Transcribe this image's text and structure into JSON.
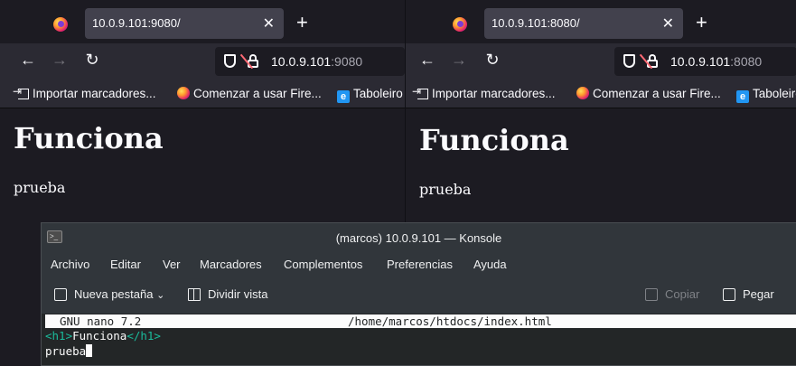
{
  "browser_left": {
    "tab_title": "10.0.9.101:9080/",
    "url_host": "10.0.9.101",
    "url_port": ":9080",
    "bookmarks": [
      "Importar marcadores...",
      "Comenzar a usar Fire...",
      "Taboleiro"
    ],
    "page": {
      "heading": "Funciona",
      "paragraph": "prueba"
    }
  },
  "browser_right": {
    "tab_title": "10.0.9.101:8080/",
    "url_host": "10.0.9.101",
    "url_port": ":8080",
    "bookmarks": [
      "Importar marcadores...",
      "Comenzar a usar Fire...",
      "Taboleiro"
    ],
    "page": {
      "heading": "Funciona",
      "paragraph": "prueba"
    }
  },
  "icons": {
    "firefox": "firefox-icon",
    "close_tab": "✕",
    "new_tab": "+",
    "back": "←",
    "forward": "→",
    "reload": "↻"
  },
  "konsole": {
    "title": "(marcos) 10.0.9.101 — Konsole",
    "menu": [
      "Archivo",
      "Editar",
      "Ver",
      "Marcadores",
      "Complementos",
      "Preferencias",
      "Ayuda"
    ],
    "toolbar": {
      "new_tab": "Nueva pestaña",
      "split_view": "Dividir vista",
      "copy": "Copiar",
      "paste": "Pegar"
    },
    "nano": {
      "version": "GNU nano 7.2",
      "file": "/home/marcos/htdocs/index.html",
      "lines": {
        "open_tag": "<h1>",
        "heading_text": "Funciona",
        "close_tag": "</h1>",
        "line2": "prueba"
      }
    }
  },
  "colors": {
    "firefox_chrome": "#2b2a33",
    "firefox_tabbar": "#1c1b22",
    "konsole_bg": "#31363b",
    "terminal_bg": "#232627",
    "html_tag": "#1abc9c"
  }
}
